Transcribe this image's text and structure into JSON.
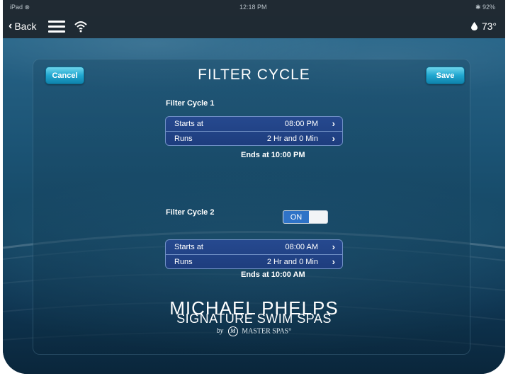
{
  "status_bar": {
    "left": "iPad ⊗",
    "time": "12:18 PM",
    "right": "✱ 92%"
  },
  "nav": {
    "back_label": "Back",
    "temperature": "73°"
  },
  "page": {
    "title": "FILTER CYCLE",
    "cancel_label": "Cancel",
    "save_label": "Save"
  },
  "filter_cycle_1": {
    "label": "Filter Cycle 1",
    "rows": [
      {
        "label": "Starts at",
        "value": "08:00 PM"
      },
      {
        "label": "Runs",
        "value": "2 Hr and 0 Min"
      }
    ],
    "ends": "Ends at 10:00 PM"
  },
  "filter_cycle_2": {
    "label": "Filter Cycle 2",
    "toggle_label": "ON",
    "rows": [
      {
        "label": "Starts at",
        "value": "08:00 AM"
      },
      {
        "label": "Runs",
        "value": "2 Hr and 0 Min"
      }
    ],
    "ends": "Ends at 10:00 AM"
  },
  "brand": {
    "line1": "MICHAEL PHELPS",
    "line2": "SIGNATURE SWIM SPAS",
    "by": "by",
    "mark": "M",
    "company": "MASTER SPAS°"
  },
  "icons": {
    "back": "chevron-left-icon",
    "menu": "hamburger-menu-icon",
    "wifi": "wifi-icon",
    "temperature": "water-drop-icon",
    "row_action": "chevron-right-icon"
  },
  "colors": {
    "accent_button": "#20a7d0",
    "row_background": "#1e3d7e",
    "toggle_on": "#2f73c7",
    "nav_bar": "#1f2a33"
  }
}
